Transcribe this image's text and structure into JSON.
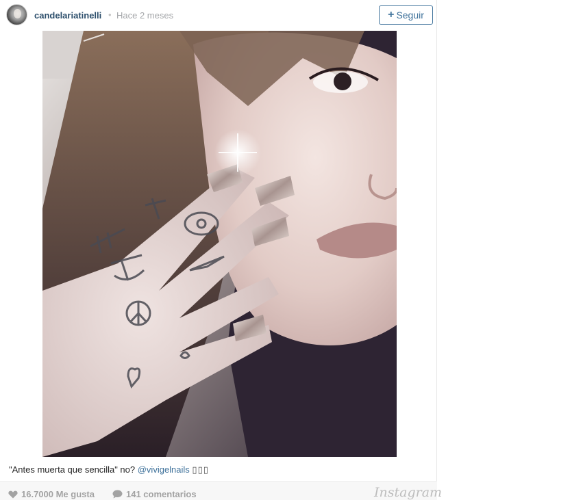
{
  "header": {
    "username": "candelariatinelli",
    "separator": "•",
    "time": "Hace 2 meses",
    "follow_label": "Seguir",
    "follow_icon": "plus-icon"
  },
  "photo": {
    "alt": "Selfie with tattooed fingers and glitter nails"
  },
  "caption": {
    "text": "\"Antes muerta que sencilla\" no? ",
    "mention": "@vivigelnails",
    "emoji": "▯▯▯"
  },
  "footer": {
    "likes": "16.7000 Me gusta",
    "likes_icon": "heart-icon",
    "comments": "141 comentarios",
    "comments_icon": "comment-bubble-icon",
    "brand": "Instagram"
  },
  "colors": {
    "link": "#3f729b",
    "username": "#2d4f6c",
    "muted": "#a3a3a3"
  }
}
